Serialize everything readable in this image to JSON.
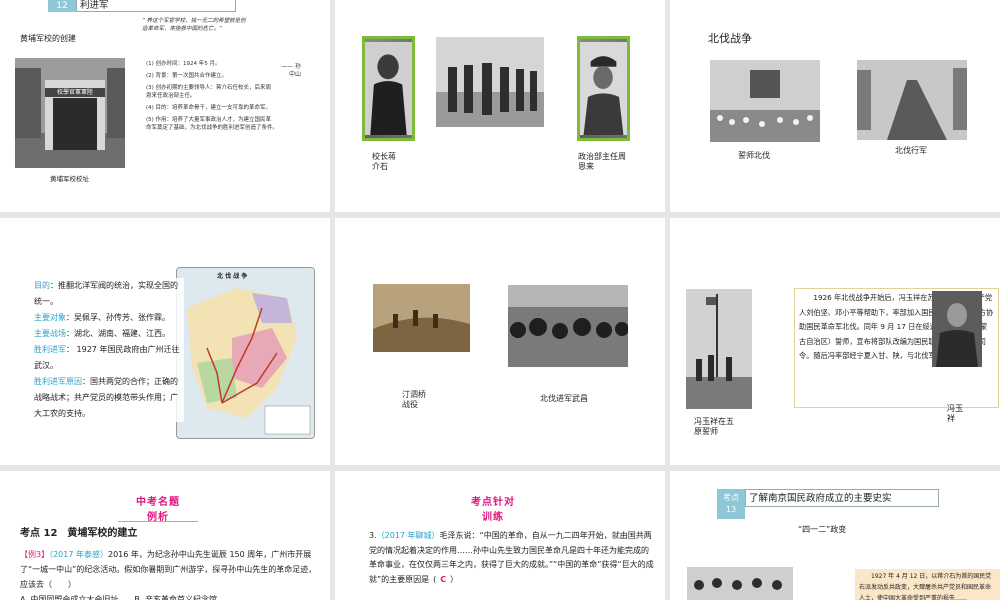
{
  "s1": {
    "section_num": "12",
    "section_title": "利进军",
    "heading": "黄埔军校的创建",
    "quote": "“ 养这个军官学校，独一无二的希望就是创\n造革命军，来挽救中国的危亡。”",
    "attribution": "—— 孙\n中山",
    "points": [
      "(1) 创办时间：1924 年5 月。",
      "(2) 背景：第一次国共合作建立。",
      "(3) 创办初期的主要领导人：蒋介石任校长，后来周\n恩来任政治部主任。",
      "(4) 目的：培养革命骨干，建立一支可靠的革命军。",
      "(5) 作用：培养了大量军事政治人才，为建立国民革\n命军奠定了基础，为北伐战争的胜利进军创造了条件。"
    ],
    "gate_sign": "校學官軍軍陸",
    "photo_caption": "黄埔军校校址"
  },
  "s2": {
    "caption_left": "校长蒋\n介石",
    "caption_right": "政治部主任周\n恩来"
  },
  "s3": {
    "title": "北伐战争",
    "caption_left": "誓师北伐",
    "caption_right": "北伐行军"
  },
  "s4": {
    "items": [
      {
        "label": "目的",
        "text": "：推翻北洋军阀的统治，实现全国的统一。"
      },
      {
        "label": "主要对象",
        "text": "：吴佩孚、孙传芳、张作霖。"
      },
      {
        "label": "主要战场",
        "text": "：湖北、湖南、福建、江西。"
      },
      {
        "label": "胜利进军",
        "text": "： 1927 年国民政府由广州迁往武汉。"
      },
      {
        "label": "胜利进军原因",
        "text": "：国共两党的合作；正确的战略战术；共产党员的模范带头作用；广大工农的支持。"
      }
    ],
    "map_title": "北 伐 战 争"
  },
  "s5": {
    "caption_left": "汀泗桥\n战役",
    "caption_right": "北伐进军武昌"
  },
  "s6": {
    "paragraph": "1926 年北伐战争开始后，冯玉祥在苏联顾问团和共产党人刘伯坚、邓小平等帮助下，率部加入国民革命军，从北方协助国民革命军北伐。同年 9 月 17 日在绥远五原（今属内蒙古自治区）誓师，宣布将部队改编为国民联军，冯自任总司令。随后冯率部经宁夏入甘、陕，与北伐军会师于中原。",
    "caption_left": "冯玉祥在五\n原誓师",
    "caption_right": "冯玉\n祥"
  },
  "s7": {
    "badge_top": "中考名题",
    "badge_bottom": "例析",
    "heading": "考点 12　黄埔军校的建立",
    "example_tag": "【例3】",
    "example_source": "（2017 年泰感）",
    "question": "2016 年，为纪念孙中山先生诞辰 150 周年，广州市开展了“一城一中山”的纪念活动。假如你暑期到广州游学，探寻孙中山先生的革命足迹，应该去（　　）",
    "options": "A. 中国同盟会成立大会旧址　　B. 辛亥革命首义纪念馆"
  },
  "s8": {
    "badge_top": "考点针对",
    "badge_bottom": "训练",
    "q_num": "3.",
    "q_source": "（2017 年聊城）",
    "question": "毛泽东说：“中国的革命，自从一九二四年开始，就由国共两党的情况起着决定的作用……孙中山先生致力国民革命凡是四十年还为能完成的革命事业，在仅仅两三年之内，获得了巨大的成就。”“中国的革命”获得“巨大的成就”的主要原因是",
    "answer": "C",
    "tail": "）"
  },
  "s9": {
    "section_num": "考点\n13",
    "section_title": "了解南京国民政府成立的主要史实",
    "subtitle": "“四一二”政变",
    "paragraph": "1927 年 4 月 12 日，以蒋介石为首的国民党右派发动反共政变，大肆屠杀共产党员和国民革命人士，使中国大革命受到严重的损失……"
  },
  "colors": {
    "accent_blue": "#2aa3c8",
    "accent_magenta": "#e0167e",
    "frame_green": "#7dbb3a"
  }
}
